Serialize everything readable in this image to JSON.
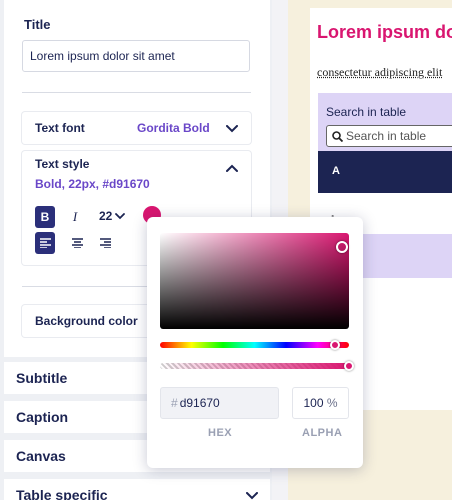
{
  "settings": {
    "title_label": "Title",
    "title_value": "Lorem ipsum dolor sit amet",
    "text_font": {
      "label": "Text font",
      "value": "Gordita Bold"
    },
    "text_style": {
      "label": "Text style",
      "value": "Bold, 22px, #d91670",
      "font_size": "22"
    },
    "style_buttons": {
      "bold": "B",
      "italic": "I"
    },
    "text_color": "#d91670",
    "background_color": {
      "label": "Background color"
    }
  },
  "sections": [
    "Subtitle",
    "Caption",
    "Canvas",
    "Table specific"
  ],
  "color_picker": {
    "hex_prefix": "#",
    "hex_value": "d91670",
    "alpha_value": "100",
    "alpha_unit": "%",
    "hex_caption": "HEX",
    "alpha_caption": "ALPHA"
  },
  "preview": {
    "title": "Lorem ipsum do",
    "subtitle": "consectetur adipiscing elit",
    "search_label": "Search in table",
    "search_placeholder": "Search in table",
    "column_header": "A",
    "first_cell": "1"
  },
  "colors": {
    "accent": "#d91670",
    "navy": "#1c2452",
    "purple_text": "#6a47c8",
    "lavender": "#ddd4f6",
    "preview_bg": "#f6f0dd"
  }
}
